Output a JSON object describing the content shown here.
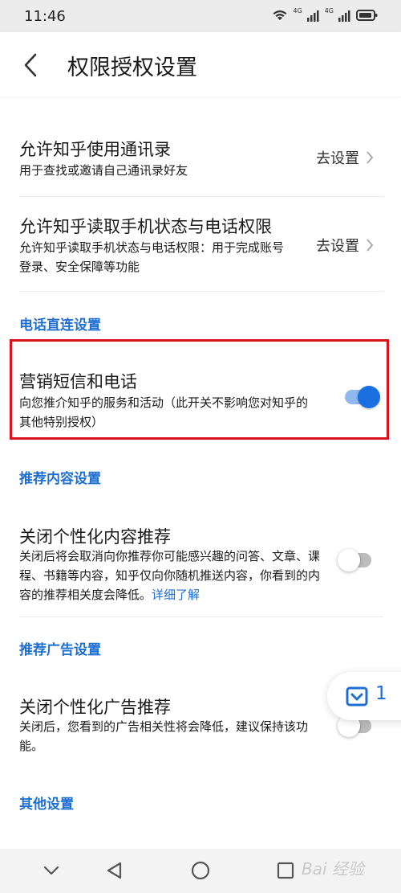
{
  "status_bar": {
    "time": "11:46",
    "signal_label_1": "4G",
    "signal_label_2": "4G"
  },
  "header": {
    "title": "权限授权设置"
  },
  "items": {
    "contacts": {
      "title": "允许知乎使用通讯录",
      "desc": "用于查找或邀请自己通讯录好友",
      "action": "去设置"
    },
    "phone_state": {
      "title": "允许知乎读取手机状态与电话权限",
      "desc": "允许知乎读取手机状态与电话权限：用于完成账号登录、安全保障等功能",
      "action": "去设置"
    },
    "marketing": {
      "title": "营销短信和电话",
      "desc": "向您推介知乎的服务和活动（此开关不影响您对知乎的其他特别授权）",
      "toggle_on": true
    },
    "personal_content": {
      "title": "关闭个性化内容推荐",
      "desc": "关闭后将会取消向你推荐你可能感兴趣的问答、文章、课程、书籍等内容，知乎仅向你随机推送内容，你看到的内容的推荐相关度会降低。",
      "link": "详细了解",
      "toggle_on": false
    },
    "personal_ads": {
      "title": "关闭个性化广告推荐",
      "desc": "关闭后，您看到的广告相关性将会降低，建议保持该功能。",
      "toggle_on": false
    }
  },
  "sections": {
    "phone_direct": "电话直连设置",
    "content_rec": "推荐内容设置",
    "ad_rec": "推荐广告设置",
    "other": "其他设置"
  },
  "float_button": {
    "count": "1"
  },
  "watermark": "Bai 经验",
  "colors": {
    "accent": "#1f6fd1",
    "highlight_border": "#d8141e",
    "toggle_on": "#1a6fe0"
  }
}
